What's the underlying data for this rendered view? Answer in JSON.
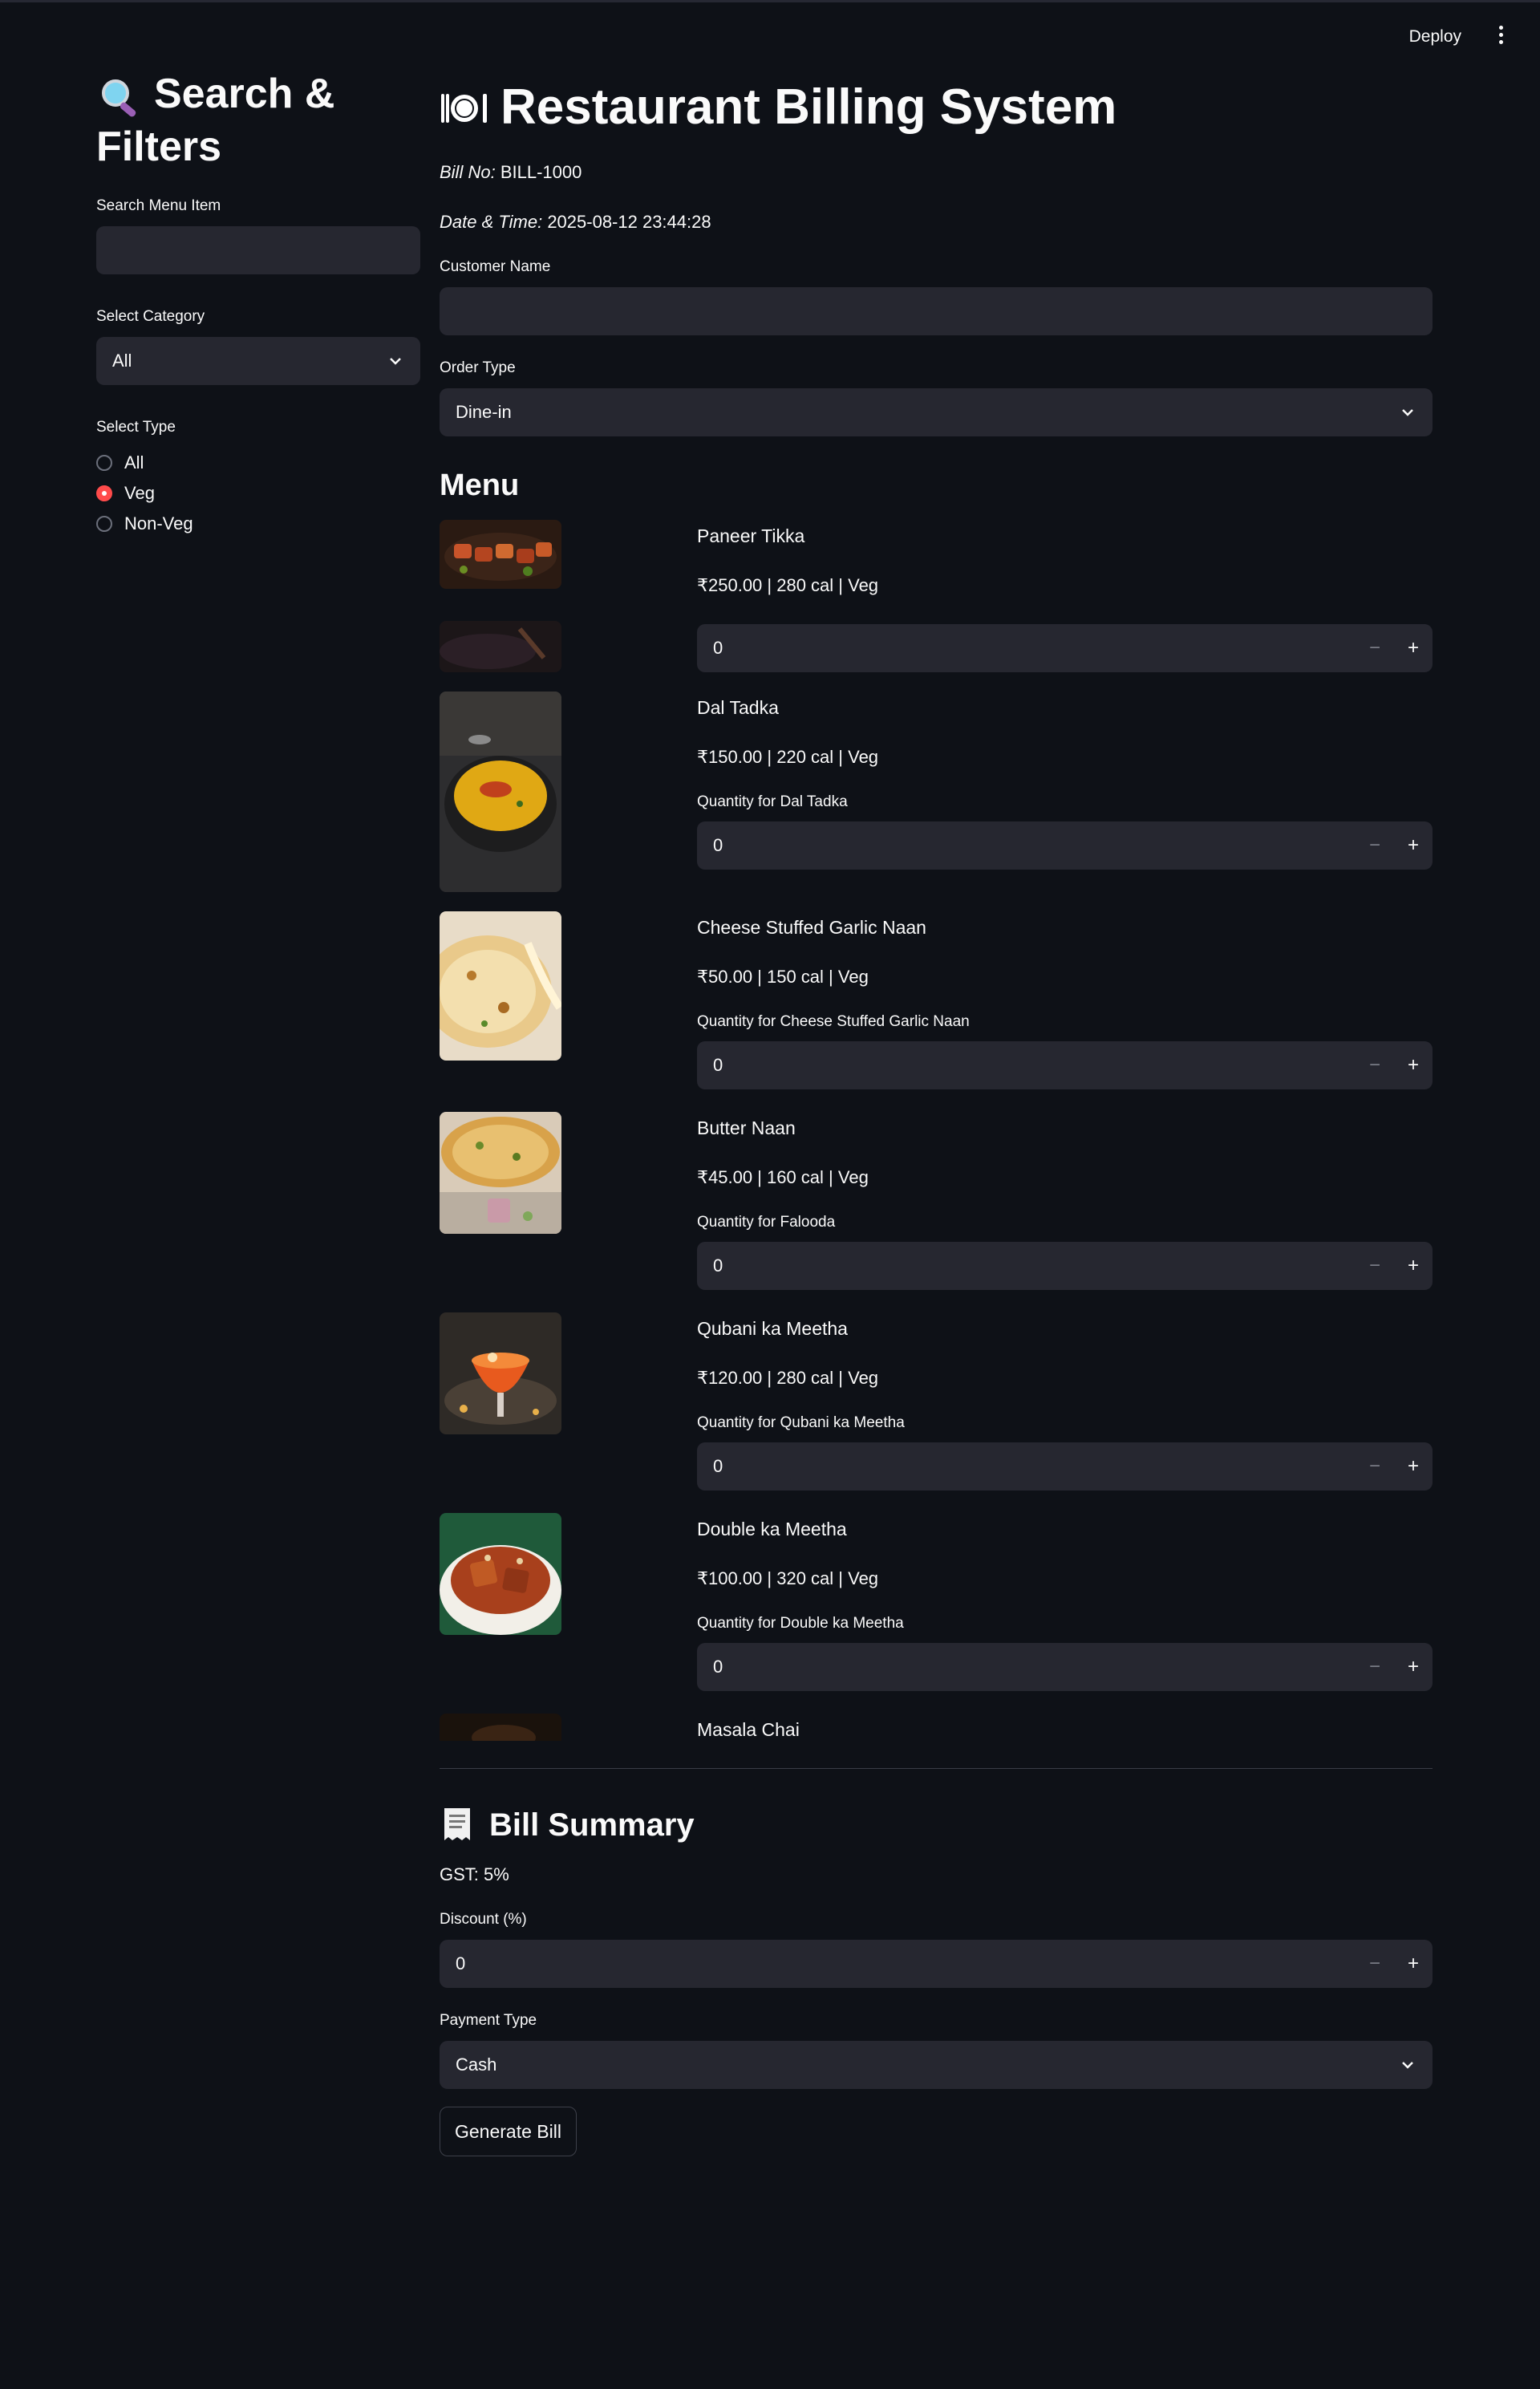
{
  "header": {
    "deploy_label": "Deploy"
  },
  "sidebar": {
    "title": "Search & Filters",
    "search_label": "Search Menu Item",
    "search_value": "",
    "category_label": "Select Category",
    "category_value": "All",
    "type_label": "Select Type",
    "type_options": [
      "All",
      "Veg",
      "Non-Veg"
    ],
    "type_selected": "Veg"
  },
  "main": {
    "title": "Restaurant Billing System",
    "bill_no_label": "Bill No:",
    "bill_no": "BILL-1000",
    "datetime_label": "Date & Time:",
    "datetime": "2025-08-12 23:44:28",
    "customer_label": "Customer Name",
    "customer_value": "",
    "order_type_label": "Order Type",
    "order_type_value": "Dine-in",
    "menu_heading": "Menu",
    "items": [
      {
        "name": "Paneer Tikka",
        "info": "₹250.00 | 280 cal | Veg",
        "qty_label": "",
        "qty": "0"
      },
      {
        "name": "Dal Tadka",
        "info": "₹150.00 | 220 cal | Veg",
        "qty_label": "Quantity for Dal Tadka",
        "qty": "0"
      },
      {
        "name": "Cheese Stuffed Garlic Naan",
        "info": "₹50.00 | 150 cal | Veg",
        "qty_label": "Quantity for Cheese Stuffed Garlic Naan",
        "qty": "0"
      },
      {
        "name": "Butter Naan",
        "info": "₹45.00 | 160 cal | Veg",
        "qty_label": "Quantity for Falooda",
        "qty": "0"
      },
      {
        "name": "Qubani ka Meetha",
        "info": "₹120.00 | 280 cal | Veg",
        "qty_label": "Quantity for Qubani ka Meetha",
        "qty": "0"
      },
      {
        "name": "Double ka Meetha",
        "info": "₹100.00 | 320 cal | Veg",
        "qty_label": "Quantity for Double ka Meetha",
        "qty": "0"
      },
      {
        "name": "Masala Chai"
      }
    ],
    "stepper_minus": "−",
    "stepper_plus": "+",
    "bill_heading": "Bill Summary",
    "gst_text": "GST: 5%",
    "discount_label": "Discount (%)",
    "discount_value": "0",
    "payment_label": "Payment Type",
    "payment_value": "Cash",
    "generate_label": "Generate Bill"
  },
  "colors": {
    "background": "#0e1117",
    "input_bg": "#262730",
    "accent": "#ff4b4b"
  }
}
